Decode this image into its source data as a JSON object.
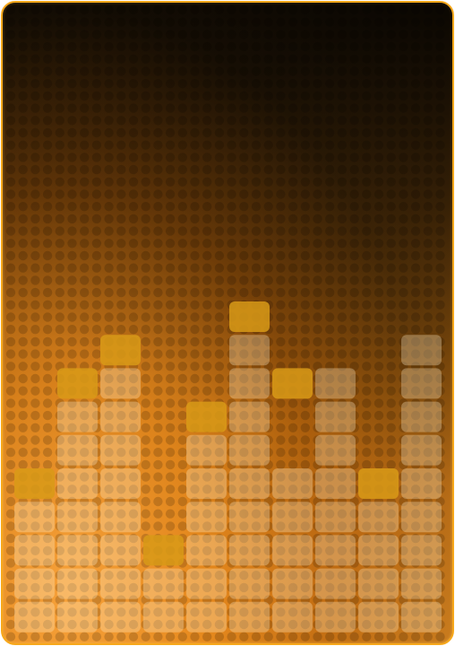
{
  "artwork": {
    "subject": "audio-equalizer-bars",
    "colors": {
      "frame_border": "#f7a81b",
      "background_dark": "#1d1407",
      "background_glow": "#f6a13a",
      "lit_block": "rgba(255,235,200,0.32)",
      "peak_block": "#d89a18"
    },
    "columns": [
      {
        "level": 4,
        "peak": 5
      },
      {
        "level": 7,
        "peak": 8
      },
      {
        "level": 8,
        "peak": 9
      },
      {
        "level": 2,
        "peak": 3
      },
      {
        "level": 6,
        "peak": 7
      },
      {
        "level": 9,
        "peak": 10
      },
      {
        "level": 5,
        "peak": 8
      },
      {
        "level": 8,
        "peak": 8
      },
      {
        "level": 4,
        "peak": 5
      },
      {
        "level": 9,
        "peak": 9
      }
    ]
  }
}
